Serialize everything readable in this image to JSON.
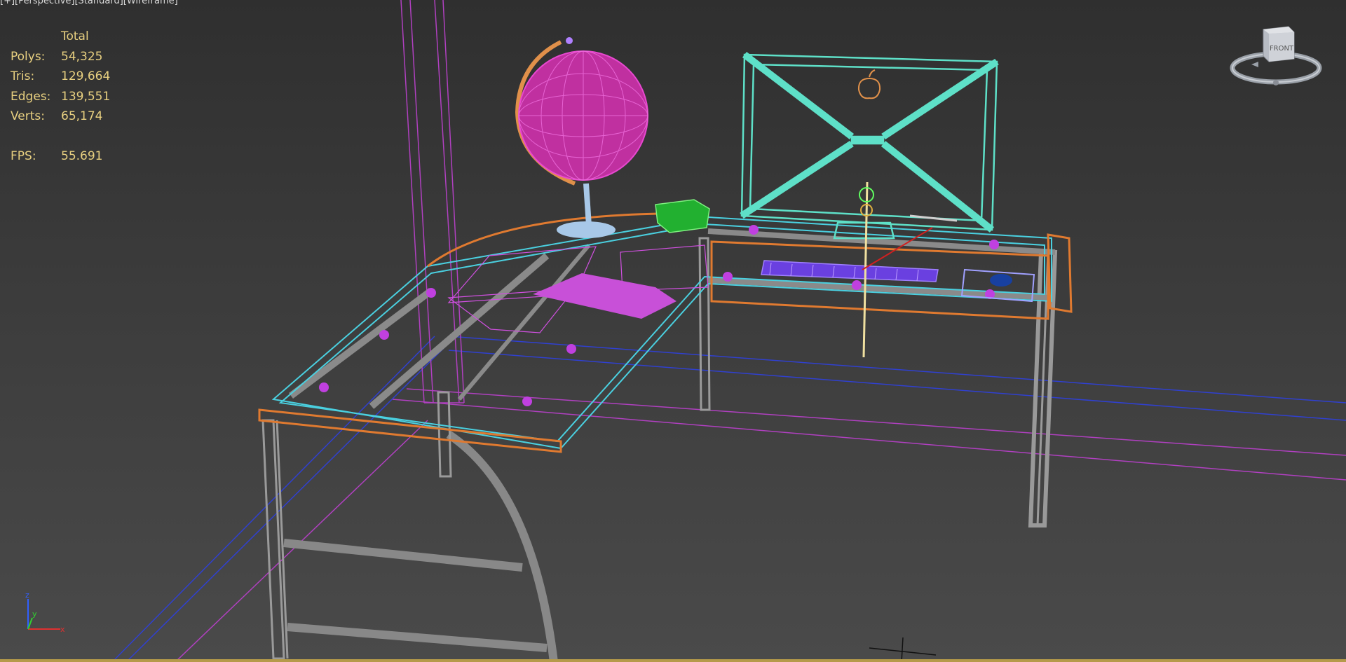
{
  "viewport": {
    "label_parts": [
      "[+]",
      "[Perspective]",
      "[Standard]",
      "[Wireframe]"
    ]
  },
  "stats": {
    "header": "Total",
    "polys_label": "Polys:",
    "polys": "54,325",
    "tris_label": "Tris:",
    "tris": "129,664",
    "edges_label": "Edges:",
    "edges": "139,551",
    "verts_label": "Verts:",
    "verts": "65,174",
    "fps_label": "FPS:",
    "fps": "55.691"
  },
  "viewcube": {
    "face_label": "FRONT",
    "icon": "viewcube-icon"
  },
  "axis": {
    "x": "x",
    "y": "y",
    "z": "z"
  },
  "colors": {
    "stats_text": "#e8d080",
    "wire_desk_top": "#4ad0e0",
    "wire_edge": "#e07a30",
    "wire_frame": "#9a9a9a",
    "globe": "#e040c0",
    "monitor": "#5ee0c8",
    "grid_blue": "#3040d0",
    "grid_magenta": "#b040c0"
  }
}
